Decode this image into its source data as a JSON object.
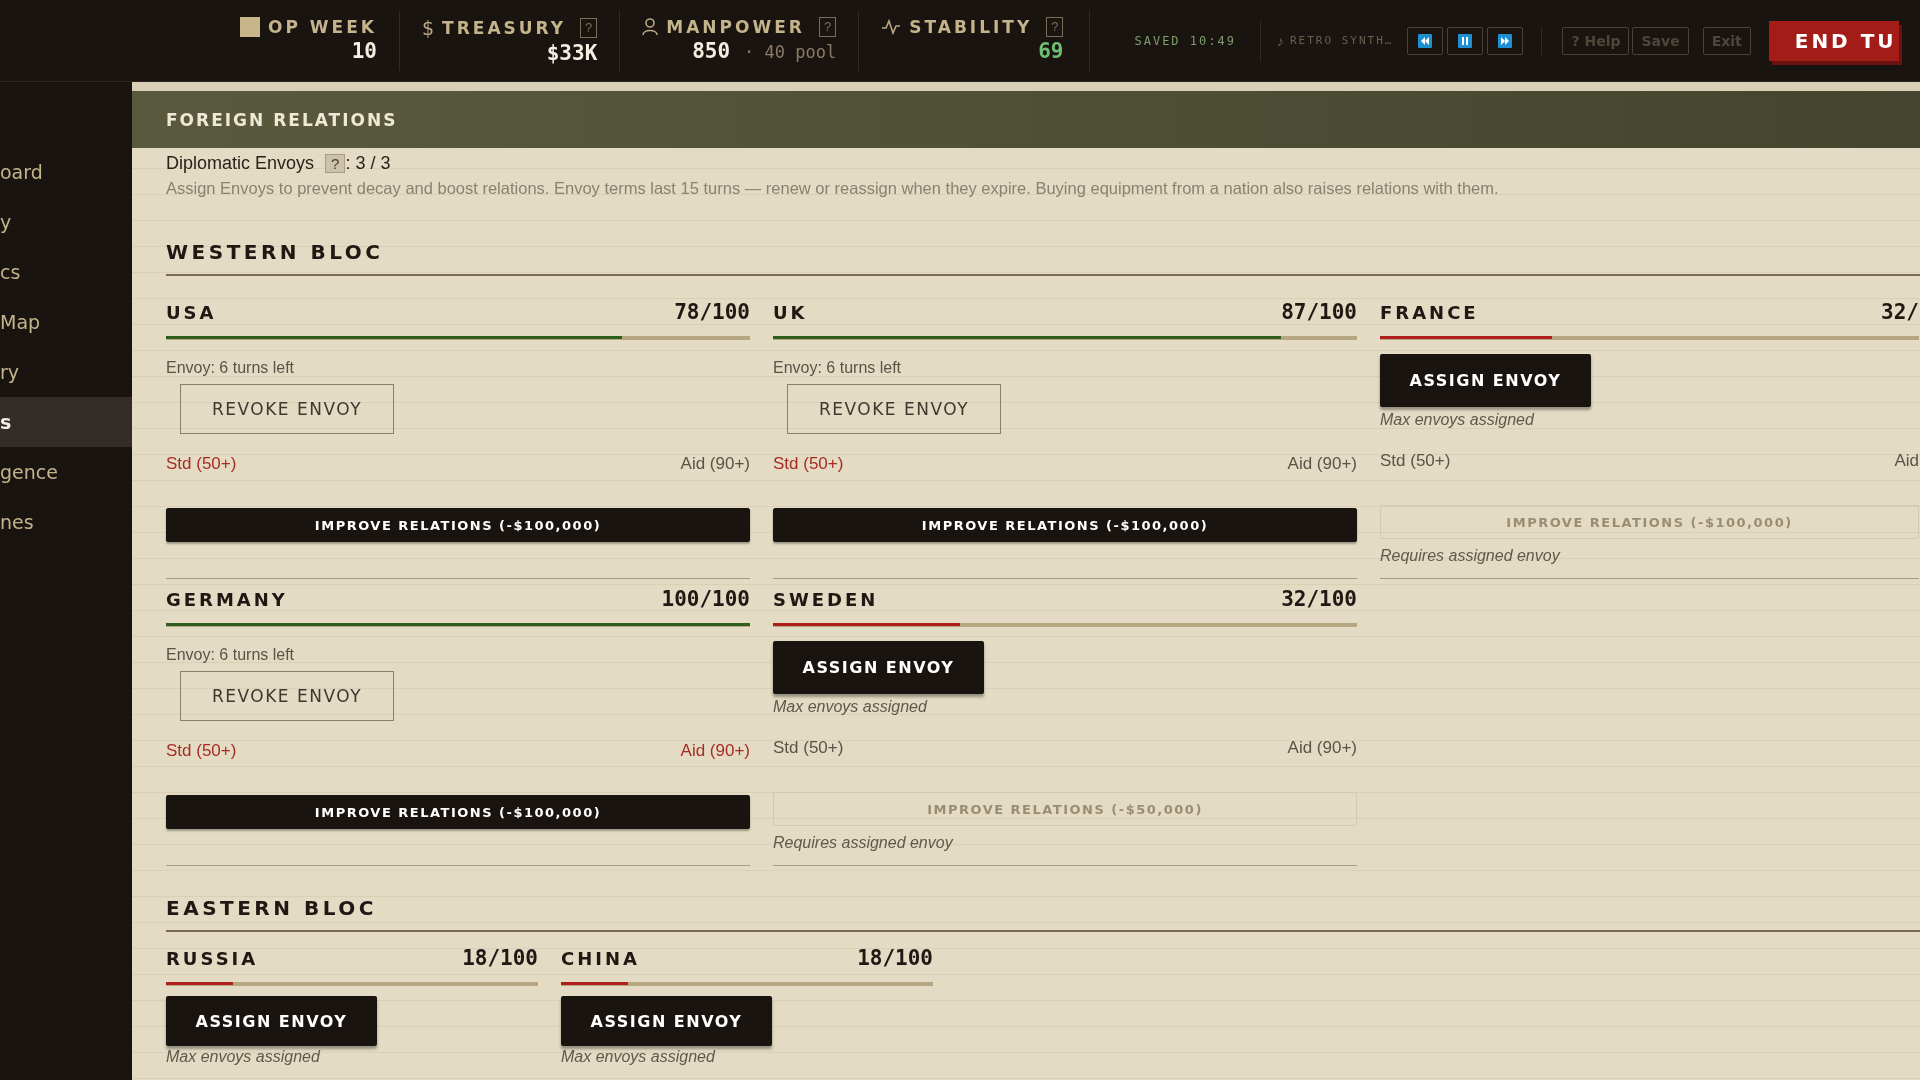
{
  "top_bar": {
    "stats": [
      {
        "kind": "week",
        "label": "OP WEEK",
        "value": "10"
      },
      {
        "kind": "treasury",
        "symbol": "$",
        "label": "TREASURY",
        "help": "?",
        "value": "$33K"
      },
      {
        "kind": "manpower",
        "label": "MANPOWER",
        "help": "?",
        "value": "850",
        "extra": "· 40 pool"
      },
      {
        "kind": "stability",
        "label": "STABILITY",
        "help": "?",
        "value": "69"
      }
    ],
    "saved": "SAVED 10:49",
    "music": {
      "symbol": "♪",
      "track": "RETRO SYNTH…"
    },
    "media_buttons": [
      {
        "kind": "previous"
      },
      {
        "kind": "pause"
      },
      {
        "kind": "next"
      }
    ],
    "buttons": [
      "? Help",
      "Save",
      "Exit"
    ],
    "end_turn": "END TU"
  },
  "sidebar": {
    "items": [
      {
        "label": "oard",
        "selected": false
      },
      {
        "label": "y",
        "selected": false
      },
      {
        "label": "cs",
        "selected": false
      },
      {
        "label": "Map",
        "selected": false
      },
      {
        "label": "ry",
        "selected": false
      },
      {
        "label": "s",
        "selected": true
      },
      {
        "label": "gence",
        "selected": false
      },
      {
        "label": "nes",
        "selected": false
      }
    ]
  },
  "panel": {
    "title": "FOREIGN RELATIONS",
    "envoys": {
      "label": "Diplomatic Envoys",
      "help": "?",
      "count": ": 3 / 3"
    },
    "description": "Assign Envoys to prevent decay and boost relations. Envoy terms last 15 turns — renew or reassign when they expire. Buying equipment from a nation also raises relations with them.",
    "blocs": [
      {
        "title": "WESTERN BLOC",
        "kind": "wide",
        "countries": [
          {
            "name": "USA",
            "score": "78/100",
            "level": 0.78,
            "envoy": "Envoy: 6 turns left",
            "action": {
              "kind": "revoke",
              "label": "REVOKE ENVOY"
            },
            "thresholds": [
              {
                "label": "Std (50+)",
                "reached": true
              },
              {
                "label": "Aid (90+)",
                "reached": false
              }
            ],
            "improve": {
              "label": "IMPROVE RELATIONS (-$100,000)",
              "disabled": false
            }
          },
          {
            "name": "UK",
            "score": "87/100",
            "level": 0.87,
            "envoy": "Envoy: 6 turns left",
            "action": {
              "kind": "revoke",
              "label": "REVOKE ENVOY"
            },
            "thresholds": [
              {
                "label": "Std (50+)",
                "reached": true
              },
              {
                "label": "Aid (90+)",
                "reached": false
              }
            ],
            "improve": {
              "label": "IMPROVE RELATIONS (-$100,000)",
              "disabled": false
            }
          },
          {
            "name": "FRANCE",
            "score": "32/",
            "level": 0.32,
            "action": {
              "kind": "assign",
              "label": "ASSIGN ENVOY",
              "note": "Max envoys assigned"
            },
            "thresholds": [
              {
                "label": "Std (50+)",
                "reached": false
              },
              {
                "label": "Aid",
                "reached": false
              }
            ],
            "improve": {
              "label": "IMPROVE RELATIONS (-$100,000)",
              "disabled": true,
              "requirement": "Requires assigned envoy"
            }
          },
          {
            "name": "GERMANY",
            "score": "100/100",
            "level": 1.0,
            "envoy": "Envoy: 6 turns left",
            "action": {
              "kind": "revoke",
              "label": "REVOKE ENVOY"
            },
            "thresholds": [
              {
                "label": "Std (50+)",
                "reached": true
              },
              {
                "label": "Aid (90+)",
                "reached": true
              }
            ],
            "improve": {
              "label": "IMPROVE RELATIONS (-$100,000)",
              "disabled": false
            }
          },
          {
            "name": "SWEDEN",
            "score": "32/100",
            "level": 0.32,
            "action": {
              "kind": "assign",
              "label": "ASSIGN ENVOY",
              "note": "Max envoys assigned"
            },
            "thresholds": [
              {
                "label": "Std (50+)",
                "reached": false
              },
              {
                "label": "Aid (90+)",
                "reached": false
              }
            ],
            "improve": {
              "label": "IMPROVE RELATIONS (-$50,000)",
              "disabled": true,
              "requirement": "Requires assigned envoy"
            }
          }
        ]
      },
      {
        "title": "EASTERN BLOC",
        "kind": "compact",
        "countries": [
          {
            "name": "RUSSIA",
            "score": "18/100",
            "level": 0.18,
            "action": {
              "kind": "assign",
              "label": "ASSIGN ENVOY",
              "note": "Max envoys assigned"
            }
          },
          {
            "name": "CHINA",
            "score": "18/100",
            "level": 0.18,
            "action": {
              "kind": "assign",
              "label": "ASSIGN ENVOY",
              "note": "Max envoys assigned"
            }
          }
        ]
      }
    ]
  }
}
